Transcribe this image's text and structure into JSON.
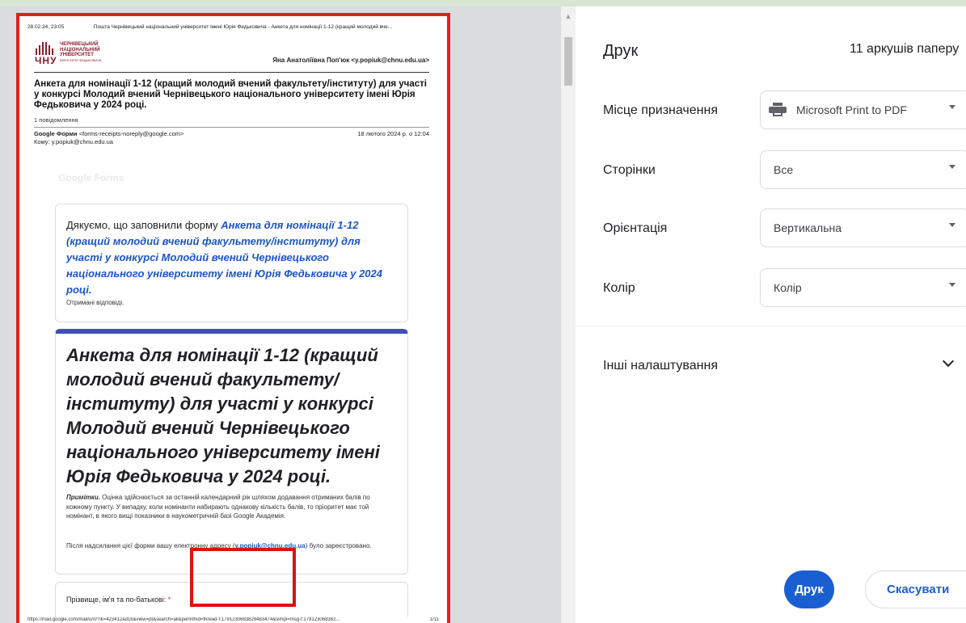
{
  "preview": {
    "header_date": "28.02.24, 23:05",
    "header_title": "Пошта Чернівецький національний університет імені Юрія Федьковича - Анкета для номінації 1-12 (кращий молодий вче...",
    "logo_lines": [
      "ЧЕРНІВЕЦЬКИЙ",
      "НАЦІОНАЛЬНИЙ",
      "УНІВЕРСИТЕТ"
    ],
    "logo_sub": "ІМЕНІ ЮРІЯ ФЕДЬКОВИЧА",
    "logo_abbr": "ЧНУ",
    "account": "Яна Анатоліївна Поп'юк <y.popiuk@chnu.edu.ua>",
    "subject": "Анкета для номінації 1-12 (кращий молодий вчений факультету/інституту) для участі у конкурсі Молодий вчений Чернівецького національного університету імені Юрія Федьковича у 2024 році.",
    "message_count": "1 повідомлення",
    "from_name": "Google Форми",
    "from_email": "<forms-receipts-noreply@google.com>",
    "sent_date": "18 лютого 2024 р. о 12:04",
    "to": "Кому: y.popiuk@chnu.edu.ua",
    "faint_logo": "Google Forms",
    "thanks_prefix": "Дякуємо, що заповнили форму ",
    "thanks_form": "Анкета для номінації 1-12 (кращий молодий вчений факультету/інституту) для участі у конкурсі Молодий вчений Чернівецького національного університету імені Юрія Федьковича у 2024 році.",
    "received": "Отримані відповіді.",
    "form_title": "Анкета для номінації 1-12 (кращий молодий вчений факультету/ інституту) для участі у конкурсі Молодий вчений Чернівецького національного університету імені Юрія Федьковича у 2024 році.",
    "note_label": "Примітки.",
    "note_text": " Оцінка здійснюється за останній календарний рік шляхом додавання отриманих балів по кожному пункту. У випадку, коли номінанти набирають однакову кількість балів, то пріоритет має той номінант, в якого вищі показники в наукометричній базі Google Академія.",
    "email_note_prefix": "Після надсилання цієї форми вашу електронну адресу (",
    "email_note_email": "y.popiuk@chnu.edu.ua",
    "email_note_suffix": ") було зареєстровано.",
    "question": "Прізвище, ім'я та по-батькові: ",
    "required_mark": "*",
    "footer_url": "https://mail.google.com/mail/u/0/?ik=423412ad1b&view=pt&search=all&permthid=thread-f:1791230683829483474&simpl=msg-f:179123068382...",
    "footer_page": "1/11"
  },
  "panel": {
    "title": "Друк",
    "sheets": "11 аркушів паперу",
    "destination_label": "Місце призначення",
    "destination_value": "Microsoft Print to PDF",
    "pages_label": "Сторінки",
    "pages_value": "Все",
    "orientation_label": "Орієнтація",
    "orientation_value": "Вертикальна",
    "color_label": "Колір",
    "color_value": "Колір",
    "more_settings": "Інші налаштування",
    "print_button": "Друк",
    "cancel_button": "Скасувати"
  },
  "colors": {
    "accent": "#1a5fd1",
    "highlight": "#e02020",
    "form_header": "#3f51b5"
  },
  "icons": [
    "printer-icon",
    "chevron-down-icon",
    "scroll-up-icon"
  ]
}
